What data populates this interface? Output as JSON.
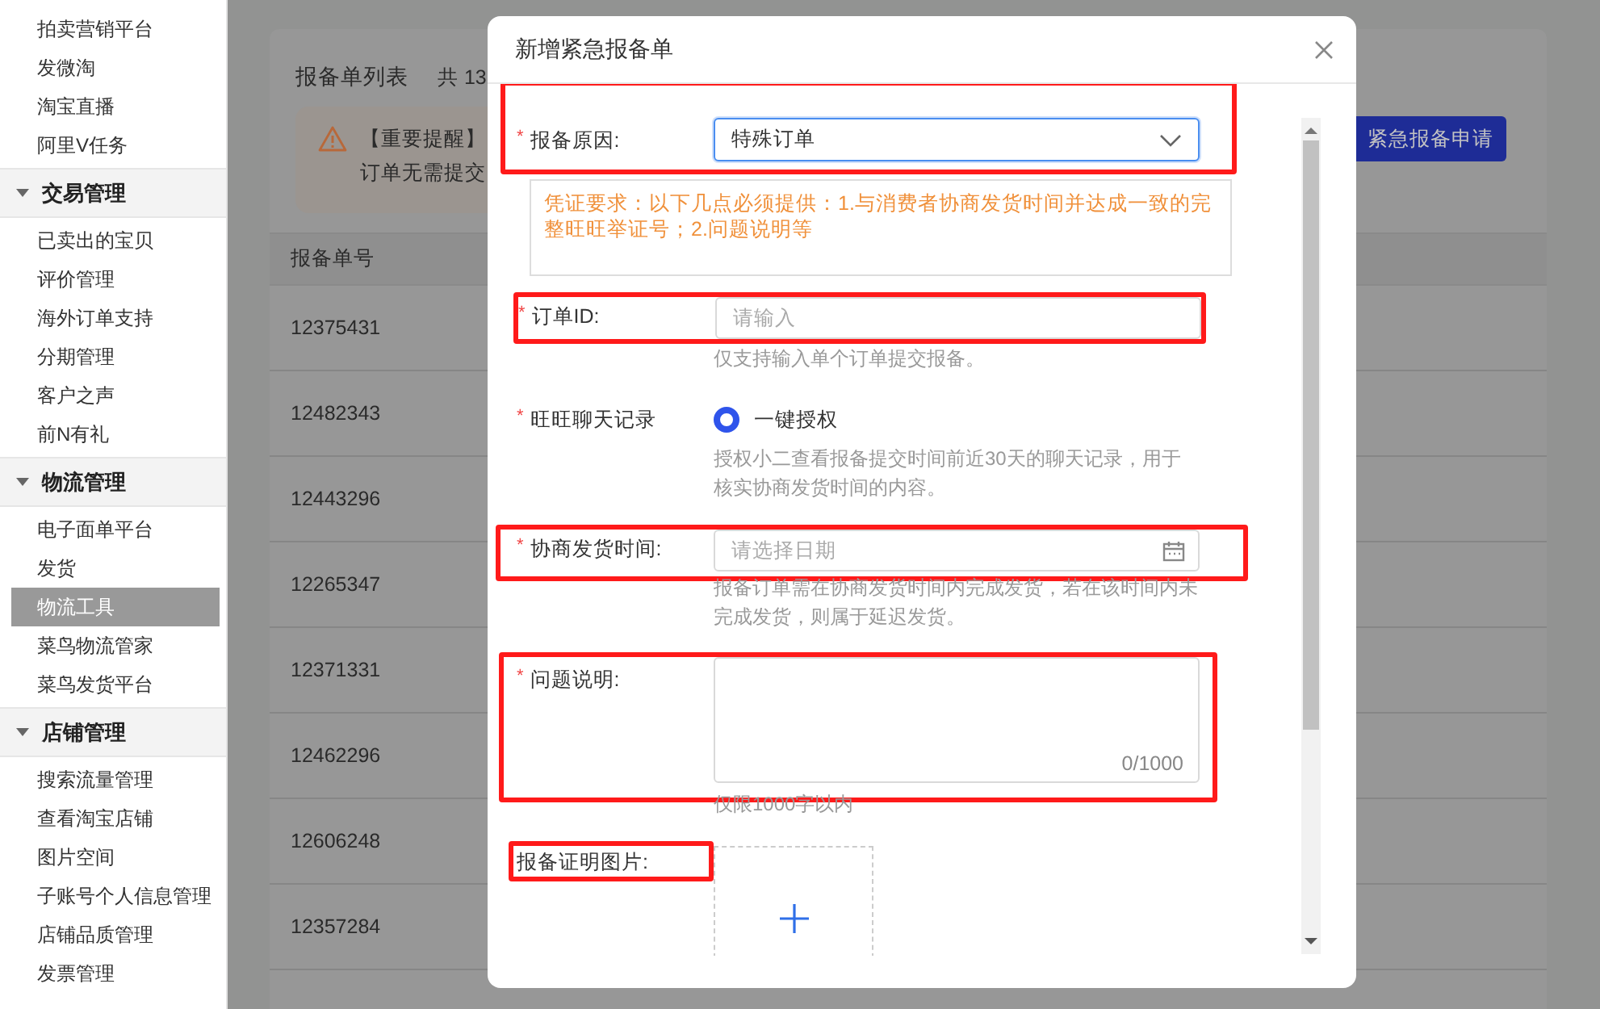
{
  "sidebar": {
    "groups": [
      {
        "items": [
          {
            "label": "拍卖营销平台",
            "selected": false
          },
          {
            "label": "发微淘",
            "selected": false
          },
          {
            "label": "淘宝直播",
            "selected": false
          },
          {
            "label": "阿里V任务",
            "selected": false
          }
        ]
      },
      {
        "title": "交易管理",
        "expanded": true,
        "items": [
          {
            "label": "已卖出的宝贝",
            "selected": false
          },
          {
            "label": "评价管理",
            "selected": false
          },
          {
            "label": "海外订单支持",
            "selected": false
          },
          {
            "label": "分期管理",
            "selected": false
          },
          {
            "label": "客户之声",
            "selected": false
          },
          {
            "label": "前N有礼",
            "selected": false
          }
        ]
      },
      {
        "title": "物流管理",
        "expanded": true,
        "items": [
          {
            "label": "电子面单平台",
            "selected": false
          },
          {
            "label": "发货",
            "selected": false
          },
          {
            "label": "物流工具",
            "selected": true
          },
          {
            "label": "菜鸟物流管家",
            "selected": false
          },
          {
            "label": "菜鸟发货平台",
            "selected": false
          }
        ]
      },
      {
        "title": "店铺管理",
        "expanded": true,
        "items": [
          {
            "label": "搜索流量管理",
            "selected": false
          },
          {
            "label": "查看淘宝店铺",
            "selected": false
          },
          {
            "label": "图片空间",
            "selected": false
          },
          {
            "label": "子账号个人信息管理",
            "selected": false
          },
          {
            "label": "店铺品质管理",
            "selected": false
          },
          {
            "label": "发票管理",
            "selected": false
          }
        ]
      }
    ]
  },
  "list": {
    "title": "报备单列表",
    "count": "共 13",
    "notice": {
      "title": "【重要提醒】",
      "line_2": "订单无需提交"
    },
    "add_button": "紧急报备申请",
    "table": {
      "columns": [
        "报备单号"
      ],
      "rows": [
        {
          "id": "12375431"
        },
        {
          "id": "12482343"
        },
        {
          "id": "12443296"
        },
        {
          "id": "12265347"
        },
        {
          "id": "12371331"
        },
        {
          "id": "12462296"
        },
        {
          "id": "12606248"
        },
        {
          "id": "12357284"
        }
      ]
    }
  },
  "dialog": {
    "title": "新增紧急报备单",
    "fields": [
      {
        "kind": "select",
        "label": "报备原因:",
        "required_mark": "*",
        "highlighted": true,
        "value": "特殊订单",
        "focused": true
      },
      {
        "kind": "notice",
        "text": "凭证要求：以下几点必须提供：1.与消费者协商发货时间并达成一致的完整旺旺举证号；2.问题说明等"
      },
      {
        "kind": "input",
        "label": "订单ID:",
        "required_mark": "*",
        "highlighted": true,
        "placeholder": "请输入",
        "hint": "仅支持输入单个订单提交报备。"
      },
      {
        "kind": "radio",
        "label": "旺旺聊天记录",
        "required_mark": "*",
        "option": "一键授权",
        "selected": true,
        "hint": "授权小二查看报备提交时间前近30天的聊天记录，用于核实协商发货时间的内容。"
      },
      {
        "kind": "date",
        "label": "协商发货时间:",
        "required_mark": "*",
        "highlighted": true,
        "placeholder": "请选择日期",
        "hint": "报备订单需在协商发货时间内完成发货，若在该时间内未完成发货，则属于延迟发货。"
      },
      {
        "kind": "textarea",
        "label": "问题说明:",
        "required_mark": "*",
        "highlighted": true,
        "counter": "0/1000",
        "hint": "仅限1000字以内"
      },
      {
        "kind": "upload",
        "label": "报备证明图片:",
        "highlighted": true
      }
    ]
  }
}
